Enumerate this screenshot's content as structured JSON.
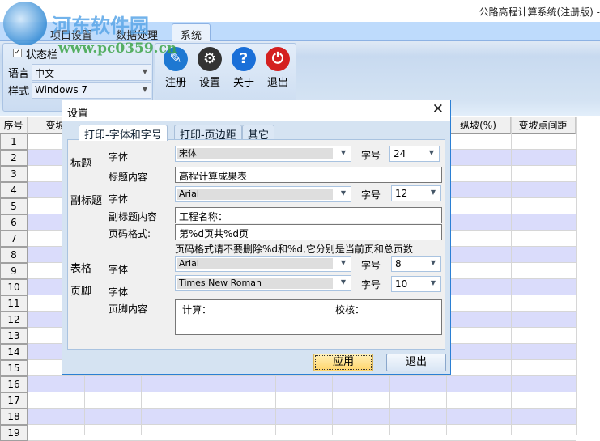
{
  "app": {
    "title": "公路高程计算系统(注册版) -",
    "watermark": {
      "name": "河东软件园",
      "url": "www.pc0359.cn"
    }
  },
  "ribbon": {
    "tabs": [
      {
        "label": "项目设置"
      },
      {
        "label": "数据处理"
      },
      {
        "label": "系统",
        "active": true
      }
    ],
    "statusbar": {
      "label": "状态栏",
      "checked": true
    },
    "language": {
      "label": "语言",
      "value": "中文"
    },
    "style": {
      "label": "样式",
      "value": "Windows 7"
    },
    "buttons": [
      {
        "label": "注册",
        "icon": "pencil-icon",
        "color": "#1e78d2"
      },
      {
        "label": "设置",
        "icon": "gear-icon",
        "color": "#333333"
      },
      {
        "label": "关于",
        "icon": "help-icon",
        "color": "#1a6fd8"
      },
      {
        "label": "退出",
        "icon": "power-icon",
        "color": "#d42020"
      }
    ]
  },
  "grid": {
    "headers": [
      "序号",
      "变坡",
      "纵坡(%)",
      "变坡点间距"
    ],
    "rows": [
      "1",
      "2",
      "3",
      "4",
      "5",
      "6",
      "7",
      "8",
      "9",
      "10",
      "11",
      "12",
      "13",
      "14",
      "15",
      "16",
      "17",
      "18",
      "19"
    ]
  },
  "dialog": {
    "title": "设置",
    "tabs": [
      "打印-字体和字号",
      "打印-页边距",
      "其它"
    ],
    "sections": {
      "title": "标题",
      "subtitle": "副标题",
      "table": "表格",
      "footer": "页脚"
    },
    "font_label": "字体",
    "size_label": "字号",
    "title_font": "宋体",
    "title_size": "24",
    "title_content_label": "标题内容",
    "title_content": "高程计算成果表",
    "subtitle_font": "Arial",
    "subtitle_size": "12",
    "subtitle_content_label": "副标题内容",
    "subtitle_content": " 工程名称：",
    "page_format_label": "页码格式:",
    "page_format": "第%d页共%d页",
    "page_format_hint": "页码格式请不要删除%d和%d,它分别是当前页和总页数",
    "table_font": "Arial",
    "table_size": "8",
    "footer_font": "Times New Roman",
    "footer_size": "10",
    "footer_content_label": "页脚内容",
    "footer_calc": "计算：",
    "footer_check": "校核：",
    "apply": "应用",
    "exit": "退出"
  }
}
